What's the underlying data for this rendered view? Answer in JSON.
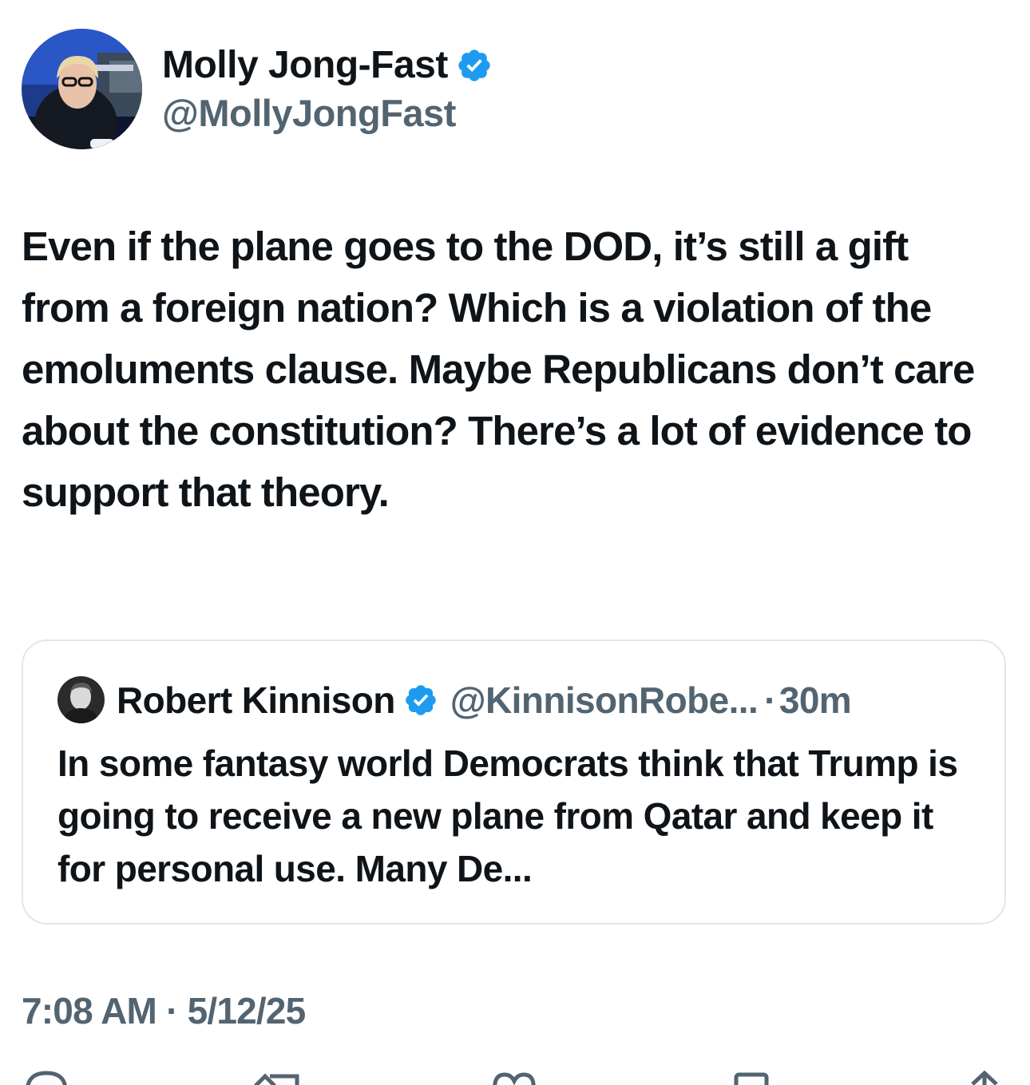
{
  "author": {
    "display_name": "Molly Jong-Fast",
    "handle": "@MollyJongFast",
    "verified": true
  },
  "tweet": {
    "text": "Even if the plane goes to the DOD, it’s still a gift from a foreign nation? Which is a violation of the emoluments clause. Maybe Republicans don’t care about the constitution? There’s a lot of evidence to support that theory.",
    "time": "7:08 AM",
    "separator": "·",
    "date": "5/12/25"
  },
  "quoted_tweet": {
    "display_name": "Robert Kinnison",
    "handle": "@KinnisonRobe...",
    "separator": "·",
    "age": "30m",
    "text": "In some fantasy world Democrats think that Trump is going to receive a new plane from Qatar and keep it for personal use. Many De...",
    "verified": true
  },
  "actions": [
    {
      "icon": "reply-icon"
    },
    {
      "icon": "retweet-icon"
    },
    {
      "icon": "like-icon"
    },
    {
      "icon": "bookmark-icon"
    },
    {
      "icon": "share-icon"
    }
  ],
  "colors": {
    "text": "#0f1419",
    "secondary": "#536471",
    "verified": "#1d9bf0",
    "border": "#e1e6ea"
  }
}
